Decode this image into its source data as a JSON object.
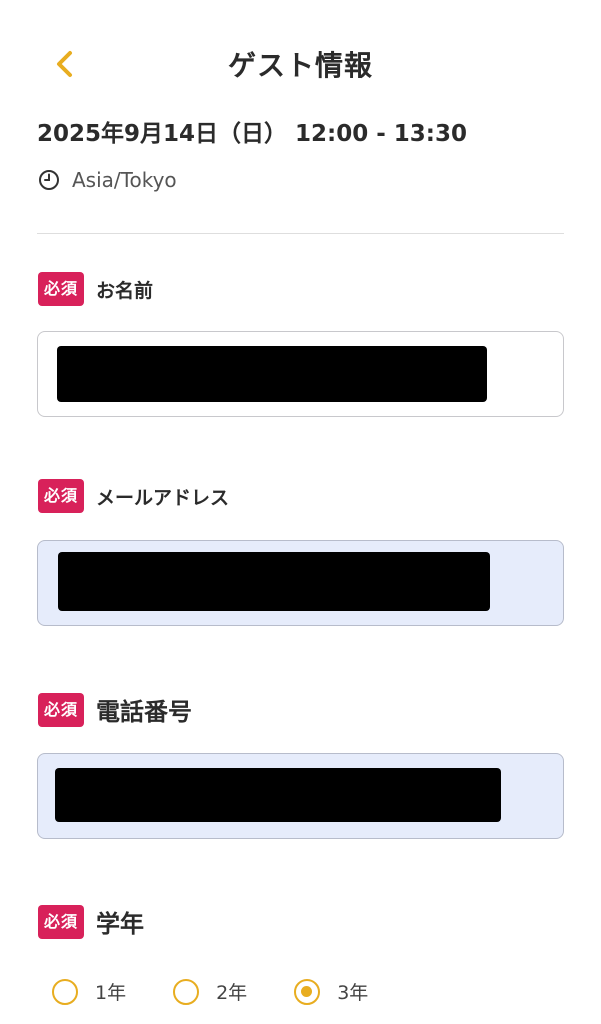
{
  "header": {
    "title": "ゲスト情報",
    "back_icon": "chevron-left-icon",
    "accent_color": "#E8AD20"
  },
  "event": {
    "datetime": "2025年9月14日（日） 12:00 - 13:30",
    "timezone": "Asia/Tokyo",
    "timezone_icon": "clock-icon"
  },
  "form": {
    "required_badge": "必須",
    "required_badge_color": "#D8215A",
    "name": {
      "label": "お名前"
    },
    "email": {
      "label": "メールアドレス"
    },
    "phone": {
      "label": "電話番号"
    },
    "grade": {
      "label": "学年",
      "options": [
        {
          "label": "1年",
          "selected": false
        },
        {
          "label": "2年",
          "selected": false
        },
        {
          "label": "3年",
          "selected": true
        }
      ]
    }
  }
}
